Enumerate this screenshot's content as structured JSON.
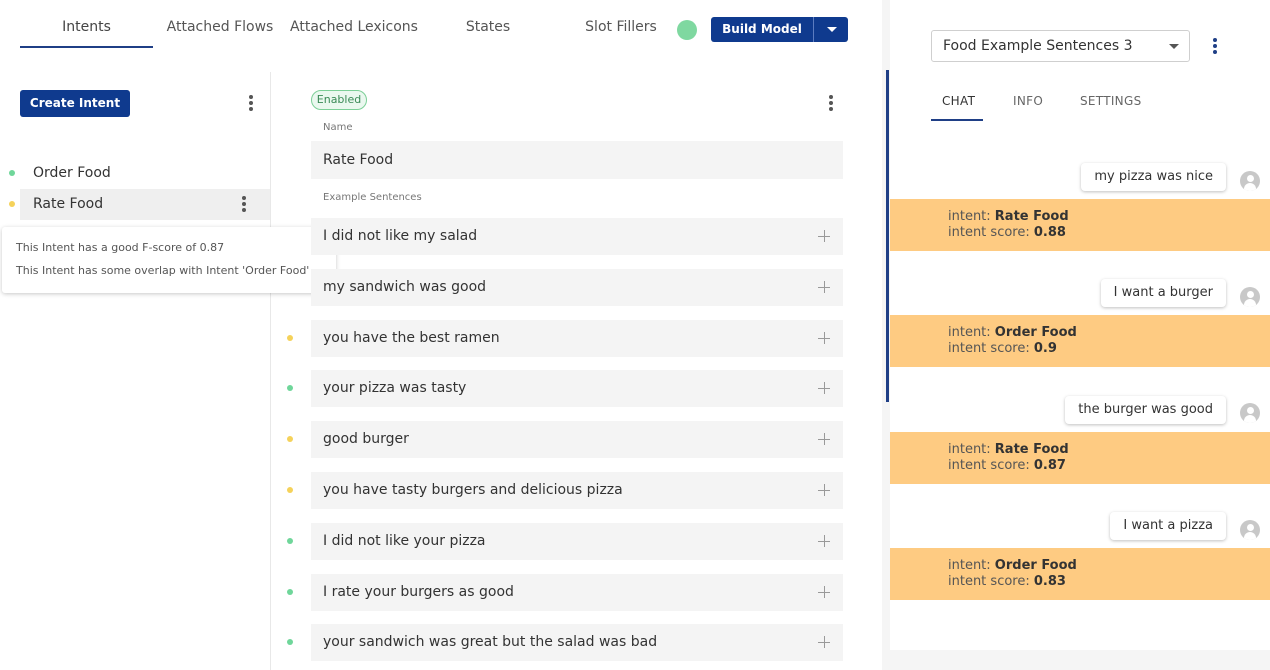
{
  "tabs": {
    "items": [
      "Intents",
      "Attached Flows",
      "Attached Lexicons",
      "States",
      "Slot Fillers"
    ],
    "active": "Intents"
  },
  "build_model": {
    "label": "Build Model"
  },
  "intents_panel": {
    "create_label": "Create Intent",
    "items": [
      {
        "label": "Order Food",
        "status": "green"
      },
      {
        "label": "Rate Food",
        "status": "yellow",
        "selected": true
      }
    ],
    "tooltip": {
      "line1": "This Intent has a good F-score of 0.87",
      "line2": "This Intent has some overlap with Intent 'Order Food'"
    }
  },
  "editor": {
    "status_badge": "Enabled",
    "name_label": "Name",
    "name_value": "Rate Food",
    "examples_label": "Example Sentences",
    "sentences": [
      {
        "text": "I did not like my salad",
        "status": ""
      },
      {
        "text": "my sandwich was good",
        "status": ""
      },
      {
        "text": "you have the best ramen",
        "status": "yellow"
      },
      {
        "text": "your pizza was tasty",
        "status": "green"
      },
      {
        "text": "good burger",
        "status": "yellow"
      },
      {
        "text": "you have tasty burgers and delicious pizza",
        "status": "yellow"
      },
      {
        "text": "I did not like your pizza",
        "status": "green"
      },
      {
        "text": "I rate your burgers as good",
        "status": "green"
      },
      {
        "text": "your sandwich was great but the salad was bad",
        "status": "green"
      }
    ]
  },
  "chat_panel": {
    "model_select": "Food Example Sentences 3",
    "tabs": [
      "CHAT",
      "INFO",
      "SETTINGS"
    ],
    "active_tab": "CHAT",
    "intent_prefix": "intent: ",
    "score_prefix": "intent score: ",
    "messages": [
      {
        "user": "my pizza was nice",
        "intent": "Rate Food",
        "score": "0.88"
      },
      {
        "user": "I want a burger",
        "intent": "Order Food",
        "score": "0.9"
      },
      {
        "user": "the burger was good",
        "intent": "Rate Food",
        "score": "0.87"
      },
      {
        "user": "I want a pizza",
        "intent": "Order Food",
        "score": "0.83"
      }
    ]
  },
  "colors": {
    "primary": "#0f3a8e",
    "status_green": "#6fd69a",
    "status_yellow": "#f5d25a",
    "result_bg": "#fecb82"
  }
}
